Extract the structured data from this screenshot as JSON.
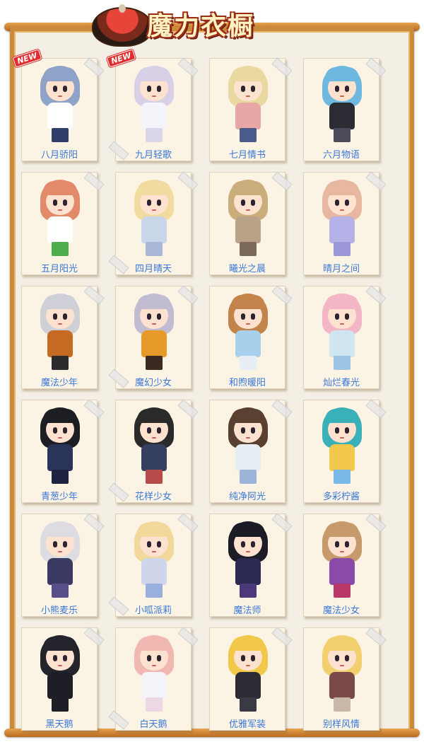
{
  "header": {
    "title": "魔力衣橱",
    "icon": "hotpot-bowl-icon"
  },
  "colors": {
    "frame": "#c98a3a",
    "paper": "#f3efe4",
    "card": "#fbf3e4",
    "label": "#3a78d8",
    "badge": "#e02d2d"
  },
  "badge_text": "NEW",
  "outfits": [
    {
      "name": "八月骄阳",
      "isNew": true,
      "hair": "#8fa3c8",
      "top": "#ffffff",
      "bottom": "#2e3f6a"
    },
    {
      "name": "九月轻歌",
      "isNew": true,
      "hair": "#d8d0e6",
      "top": "#f4f4fa",
      "bottom": "#dcd6ec"
    },
    {
      "name": "七月情书",
      "isNew": false,
      "hair": "#e9d9a0",
      "top": "#e8a7a7",
      "bottom": "#4a5a8a"
    },
    {
      "name": "六月物语",
      "isNew": false,
      "hair": "#6fb9e0",
      "top": "#2c2c34",
      "bottom": "#4a4a58"
    },
    {
      "name": "五月阳光",
      "isNew": false,
      "hair": "#e38a6a",
      "top": "#ffffff",
      "bottom": "#4cae4c"
    },
    {
      "name": "四月晴天",
      "isNew": false,
      "hair": "#f0dca0",
      "top": "#c9d6ea",
      "bottom": "#a9b8d6"
    },
    {
      "name": "曦光之晨",
      "isNew": false,
      "hair": "#c9ae7c",
      "top": "#b9a388",
      "bottom": "#7a6a5a"
    },
    {
      "name": "晴月之间",
      "isNew": false,
      "hair": "#e7b7a0",
      "top": "#b4b2e6",
      "bottom": "#9c98d8"
    },
    {
      "name": "魔法少年",
      "isNew": false,
      "hair": "#cfcfd8",
      "top": "#c56a22",
      "bottom": "#2c2c2c"
    },
    {
      "name": "魔幻少女",
      "isNew": false,
      "hair": "#c2bcd2",
      "top": "#e69a2a",
      "bottom": "#3a2a22"
    },
    {
      "name": "和煦暖阳",
      "isNew": false,
      "hair": "#c2844a",
      "top": "#a8d0ec",
      "bottom": "#e8eef6"
    },
    {
      "name": "灿烂春光",
      "isNew": false,
      "hair": "#f2b6c6",
      "top": "#cfe6f2",
      "bottom": "#9cc4e4"
    },
    {
      "name": "青葱少年",
      "isNew": false,
      "hair": "#1d1d24",
      "top": "#2a3458",
      "bottom": "#1e2440"
    },
    {
      "name": "花样少女",
      "isNew": false,
      "hair": "#2a2a2a",
      "top": "#34405e",
      "bottom": "#b84a4a"
    },
    {
      "name": "纯净阿光",
      "isNew": false,
      "hair": "#5a4030",
      "top": "#e8eef6",
      "bottom": "#9bb4d8"
    },
    {
      "name": "多彩柠酱",
      "isNew": false,
      "hair": "#3ab0b8",
      "top": "#f2c94c",
      "bottom": "#7ab8e8"
    },
    {
      "name": "小熊麦乐",
      "isNew": false,
      "hair": "#dcdce2",
      "top": "#3a3a62",
      "bottom": "#5a4e8a"
    },
    {
      "name": "小呱派莉",
      "isNew": false,
      "hair": "#f2d89a",
      "top": "#cfd6ec",
      "bottom": "#9ab0dc"
    },
    {
      "name": "魔法师",
      "isNew": false,
      "hair": "#1c1c26",
      "top": "#2c2a52",
      "bottom": "#4a3a7a"
    },
    {
      "name": "魔法少女",
      "isNew": false,
      "hair": "#c69a6a",
      "top": "#8a4aa8",
      "bottom": "#b8386a"
    },
    {
      "name": "黑天鹅",
      "isNew": false,
      "hair": "#24242c",
      "top": "#1e1e26",
      "bottom": "#1e1e26"
    },
    {
      "name": "白天鹅",
      "isNew": false,
      "hair": "#f0b8b0",
      "top": "#f4f4f8",
      "bottom": "#ecd8e4"
    },
    {
      "name": "优雅军装",
      "isNew": false,
      "hair": "#f2c84a",
      "top": "#2c2c34",
      "bottom": "#3a3a44"
    },
    {
      "name": "别样风情",
      "isNew": false,
      "hair": "#f2d070",
      "top": "#7a4a4a",
      "bottom": "#c8b8a8"
    }
  ]
}
